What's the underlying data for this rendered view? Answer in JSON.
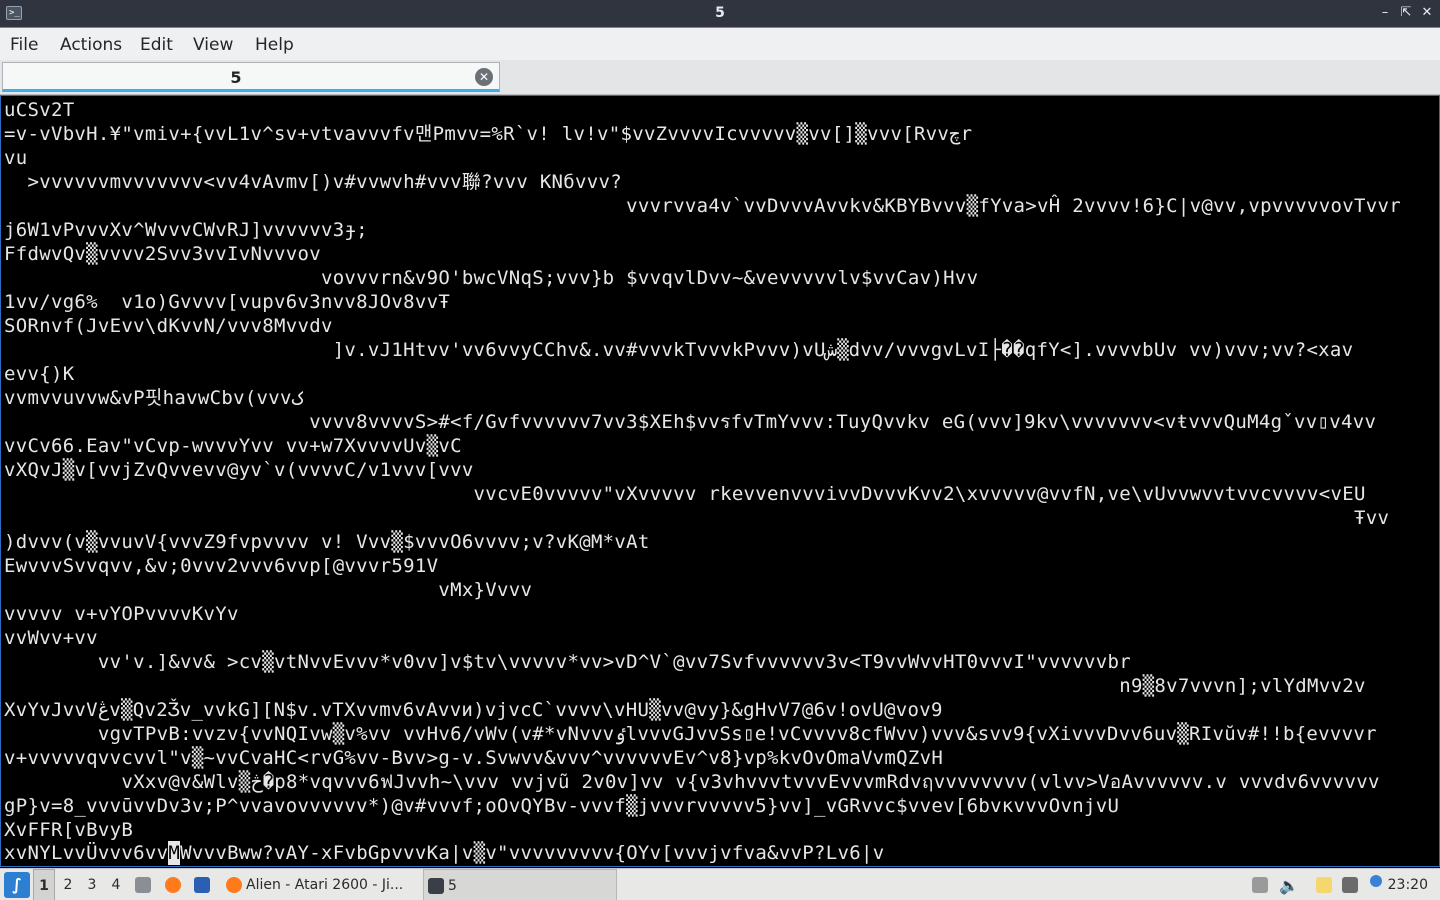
{
  "window": {
    "title": "5"
  },
  "menubar": {
    "file": "File",
    "actions": "Actions",
    "edit": "Edit",
    "view": "View",
    "help": "Help"
  },
  "tab": {
    "label": "5"
  },
  "terminal": {
    "lines": [
      "uCSv2T",
      "=v-vVbvH.¥\"vmiv+{vvL1v^sv+vtvavvvfv맨Pmvv=%R`v! lv!v\"$vvZvvvvIcvvvvv▒vv[]▒vvv[Rvvچr",
      "vu",
      "  >vvvvvvmvvvvvvv<vv4vAvmv[)v#vvwvh#vvv聯?vvv KNбvvv?",
      "                                                     vvvrvva4v`vvDvvvAvvkv&KBYBvvv▒fYva>vĤ 2vvvv!6}C|v@vv,vpvvvvvovTvvr",
      "j6W1vPvvvXv^WvvvCWvRJ]vvvvvv3ɟ;",
      "FfdwvQv▒vvvv2Svv3vvIvNvvvov",
      "                           vovvvrn&v9O'bwcVNqS;vvv}b $vvqvlDvv~&vevvvvvlv$vvCav)Hvv",
      "1vv/vg6%  v1o)Gvvvv[vupv6v3nvv8JOv8vvŦ",
      "SORnvf(JvEvv\\dKvvN/vvv8Mvvdv",
      "                            ]v.vJ1Htvv'vv6vvyCChv&.vv#vvvkTvvvkPvvv)vUش▒dvv/vvvgvLvI├��qfY<].vvvvbUv vv)vvv;vv?<xav",
      "evv{)K",
      "vvmvvuvvw&vP핏havwCbv(vvvک",
      "                          vvvv8vvvvS>#<f/Gvfvvvvvv7vv3$XEh$vvรfvTmYvvv:TuyQvvkv eG(vvv]9kv\\vvvvvvv<vŧvvvQuM4gˇvv▯v4vv",
      "vvCv66.Eav\"vCvp-wvvvYvv vv+w7XvvvvUv▒vC",
      "vXQvJ▒v[vvjZvQvvevv@yv`v(vvvvC/v1vvv[vvv",
      "                                        vvcvE0vvvvv\"vXvvvvv rkevvenvvvivvDvvvKvv2\\xvvvvv@vvfN,ve\\vUvvwvvtvvcvvvv<vEU",
      "                                                                                                                   Ŧvv",
      ")dvvv(v▒vvuvV{vvvZ9fvpvvvv v! Vvv▒$vvvO6vvvv;v?vK@M*vAt",
      "EwvvvSvvqvv,&v;0vvv2vvv6vvp[@vvvr591V",
      "                                     vMx}Vvvv",
      "vvvvv v+vYOPvvvvKvYv",
      "vvWvv+vv",
      "        vv'v.]&vv& >cv▒vtNvvEvvv*v0vv]v$tv\\vvvvv*vv>vD^V`@vv7Svfvvvvvv3v<T9vvWvvHT0vvvI\"vvvvvvbr",
      "                                                                                               n9▒8v7vvvn];vlYdMvv2v",
      "XvYvJvvVڠv▒Qv2Ǯv_vvkG][N$v.vTXvvmv6vAvvи)vjvcC`vvvv\\vHU▒vv@vy}&gHvV7@6v!ovU@vov9",
      "        vgvTPvB:vvzv{vvNQIvw▒v%vv vvHv6/vWv(v#*vNvvvٶlvvvGJvvSs▯e!vCvvvv8cfWvv)vvv&svv9{vXivvvDvv6uv▒RIvŭv#!!b{evvvvr",
      "v+vvvvvqvvcvvl\"v▒~vvCvaHC<rvG%vv-Bvv>g-v.Svwvv&vvv^vvvvvvEv^v8}vp%kvOvOmaVvmQZvH",
      "          vXxv@v&Wlv▒څ�p8*vqvvv6ฟJvvh~\\vvv vvjvũ 2v0v]vv v{v3vhvvvtvvvEvvvmRdvฤvvvvvvvv(vlvv>VอAvvvvvv.v vvvdv6vvvvvv",
      "gP}v=8_vvvūvvDv3v;P^vvavovvvvvv*)@v#vvvf;oOvQYBv-vvvf▒jvvvrvvvvv5}vv]_vGRvvc$vvev[6bvкvvvOvnjvU",
      "XvFFR[vBvyB"
    ],
    "prompt_before_cursor": "xvNYLvvÜvvv6vv",
    "cursor_char": "M",
    "prompt_after_cursor": "WvvvBww?vAY-xFvbGpvvvKa|v▒v\"vvvvvvvvv{OYv[vvvjvfva&vvP?Lv6|v"
  },
  "taskbar": {
    "workspaces": [
      "1",
      "2",
      "3",
      "4"
    ],
    "active_workspace": "1",
    "tasks": [
      {
        "label": "Alien - Atari 2600 - Ji...",
        "icon": "firefox-icon"
      },
      {
        "label": "5",
        "icon": "terminal-icon"
      }
    ],
    "clock": "23:20"
  },
  "colors": {
    "titlebar_bg": "#2f343f",
    "accent": "#3daee9",
    "terminal_bg": "#000000",
    "terminal_fg": "#e6e6e6"
  }
}
